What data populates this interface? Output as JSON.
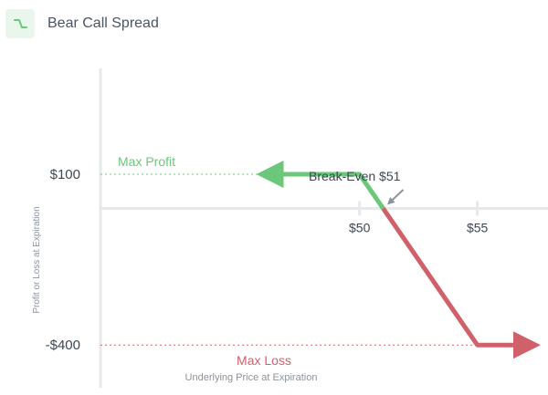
{
  "header": {
    "icon": "bear-call-spread-icon",
    "title": "Bear Call Spread"
  },
  "colors": {
    "profit": "#6bc77a",
    "loss": "#d0616a",
    "axis": "#e6e8ec",
    "text": "#3d4753",
    "muted": "#8b939c",
    "icon_bg": "#e9f6ec"
  },
  "chart_data": {
    "type": "line",
    "title": "Bear Call Spread",
    "xlabel": "Underlying Price at Expiration",
    "ylabel": "Profit or Loss at Expiration",
    "x_ticks": [
      {
        "value": 50,
        "label": "$50"
      },
      {
        "value": 55,
        "label": "$55"
      }
    ],
    "y_ticks": [
      {
        "value": 100,
        "label": "$100"
      },
      {
        "value": -400,
        "label": "-$400"
      }
    ],
    "xlim": [
      39,
      58
    ],
    "ylim": [
      -525,
      410
    ],
    "series": [
      {
        "segment": "profit",
        "points": [
          {
            "x": 46,
            "y": 100
          },
          {
            "x": 50,
            "y": 100
          },
          {
            "x": 51,
            "y": 0
          }
        ]
      },
      {
        "segment": "loss",
        "points": [
          {
            "x": 51,
            "y": 0
          },
          {
            "x": 55,
            "y": -400
          },
          {
            "x": 57.3,
            "y": -400
          }
        ]
      }
    ],
    "annotations": {
      "max_profit": {
        "label": "Max Profit",
        "value": 100
      },
      "max_loss": {
        "label": "Max Loss",
        "value": -400
      },
      "break_even": {
        "label": "Break-Even $51",
        "value": 51
      }
    },
    "grid": false,
    "legend": "none"
  }
}
